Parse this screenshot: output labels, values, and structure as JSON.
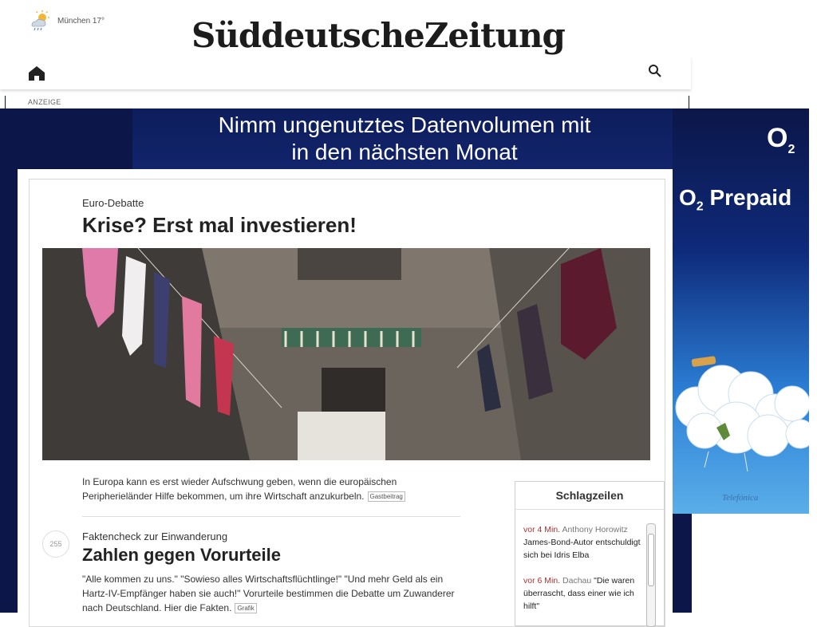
{
  "header": {
    "weather_text": "München 17°",
    "weather_icon": "sun-cloud-rain-icon",
    "masthead": "SüddeutscheZeitung",
    "ad_label": "ANZEIGE"
  },
  "ad": {
    "headline_line1": "Nimm ungenutztes Datenvolumen mit",
    "headline_line2": "in den nächsten Monat",
    "brand": "O",
    "brand_sub": "2",
    "product": "O",
    "product_sub": "2",
    "product_name": " Prepaid",
    "company": "Telefónica",
    "colors": {
      "dark_navy": "#0c1648",
      "sky_blue": "#2b7fd6"
    }
  },
  "articles": [
    {
      "kicker": "Euro-Debatte",
      "title": "Krise? Erst mal investieren!",
      "teaser": "In Europa kann es erst wieder Aufschwung geben, wenn die europäischen Peripherieländer Hilfe bekommen, um ihre Wirtschaft anzukurbeln.",
      "tag": "Gastbeitrag"
    },
    {
      "comment_count": "255",
      "kicker": "Faktencheck zur Einwanderung",
      "title": "Zahlen gegen Vorurteile",
      "teaser": "\"Alle kommen zu uns.\" \"Sowieso alles Wirtschaftsflüchtlinge!\" \"Und mehr Geld als ein Hartz-IV-Empfänger haben sie auch!\" Vorurteile bestimmen die Debatte um Zuwanderer nach Deutschland. Hier die Fakten.",
      "tag": "Grafik"
    }
  ],
  "headlines_box": {
    "title": "Schlagzeilen",
    "items": [
      {
        "time": "vor 4 Min.",
        "source": "Anthony Horowitz",
        "text": "James-Bond-Autor entschuldigt sich bei Idris Elba"
      },
      {
        "time": "vor 6 Min.",
        "source": "Dachau",
        "text": "\"Die waren überrascht, dass einer wie ich hilft\""
      }
    ]
  }
}
